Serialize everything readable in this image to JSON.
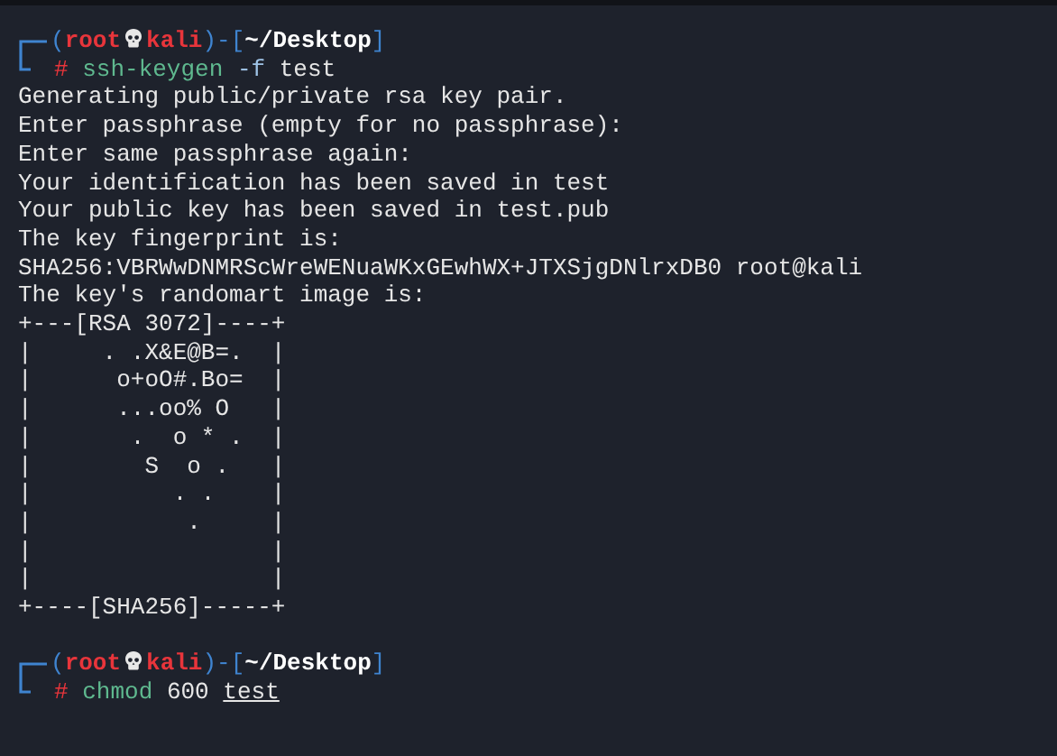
{
  "terminal": {
    "lines": [
      {
        "kind": "prompt",
        "user": "root",
        "host": "kali",
        "path": "~/Desktop",
        "brackets": [
          "(",
          ")-[",
          "]"
        ],
        "symbol": "#",
        "command": "ssh-keygen",
        "args": [
          {
            "text": "-f",
            "kind": "option",
            "underlined": false
          },
          {
            "text": "test",
            "kind": "plain",
            "underlined": false
          }
        ]
      },
      {
        "kind": "output",
        "text": "Generating public/private rsa key pair."
      },
      {
        "kind": "output",
        "text": "Enter passphrase (empty for no passphrase):"
      },
      {
        "kind": "output",
        "text": "Enter same passphrase again:"
      },
      {
        "kind": "output",
        "text": "Your identification has been saved in test"
      },
      {
        "kind": "output",
        "text": "Your public key has been saved in test.pub"
      },
      {
        "kind": "output",
        "text": "The key fingerprint is:"
      },
      {
        "kind": "output",
        "text": "SHA256:VBRWwDNMRScWreWENuaWKxGEwhWX+JTXSjgDNlrxDB0 root@kali"
      },
      {
        "kind": "output",
        "text": "The key's randomart image is:"
      },
      {
        "kind": "output",
        "text": "+---[RSA 3072]----+"
      },
      {
        "kind": "output",
        "text": "|     . .X&E@B=.  |"
      },
      {
        "kind": "output",
        "text": "|      o+oO#.Bo=  |"
      },
      {
        "kind": "output",
        "text": "|      ...oo% O   |"
      },
      {
        "kind": "output",
        "text": "|       .  o * .  |"
      },
      {
        "kind": "output",
        "text": "|        S  o .   |"
      },
      {
        "kind": "output",
        "text": "|          . .    |"
      },
      {
        "kind": "output",
        "text": "|           .     |"
      },
      {
        "kind": "output",
        "text": "|                 |"
      },
      {
        "kind": "output",
        "text": "|                 |"
      },
      {
        "kind": "output",
        "text": "+----[SHA256]-----+"
      },
      {
        "kind": "blank"
      },
      {
        "kind": "prompt",
        "user": "root",
        "host": "kali",
        "path": "~/Desktop",
        "brackets": [
          "(",
          ")-[",
          "]"
        ],
        "symbol": "#",
        "command": "chmod",
        "args": [
          {
            "text": "600",
            "kind": "plain",
            "underlined": false
          },
          {
            "text": "test",
            "kind": "plain",
            "underlined": true
          }
        ]
      }
    ]
  }
}
